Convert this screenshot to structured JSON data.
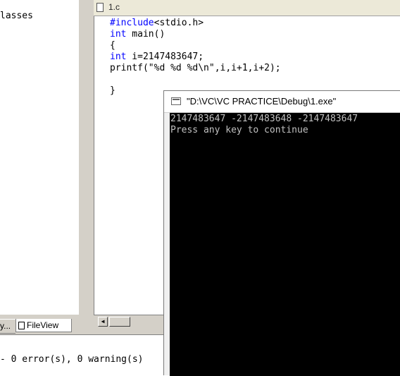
{
  "workspace": {
    "tree_text": "lasses",
    "tab_classview": "y...",
    "tab_fileview": "FileView"
  },
  "editor": {
    "title": "1.c",
    "code_lines": [
      {
        "kw": "#include",
        "rest": "<stdio.h>"
      },
      {
        "kw": "int",
        "rest": " main()"
      },
      {
        "kw": "",
        "rest": "{"
      },
      {
        "kw": "int",
        "rest": " i=2147483647;"
      },
      {
        "kw": "",
        "rest": "printf(\"%d %d %d\\n\",i,i+1,i+2);"
      },
      {
        "kw": "",
        "rest": ""
      },
      {
        "kw": "",
        "rest": "}"
      }
    ]
  },
  "output": {
    "text": "- 0 error(s), 0 warning(s)"
  },
  "console": {
    "title": "\"D:\\VC\\VC PRACTICE\\Debug\\1.exe\"",
    "lines": [
      "2147483647 -2147483648 -2147483647",
      "Press any key to continue"
    ]
  }
}
